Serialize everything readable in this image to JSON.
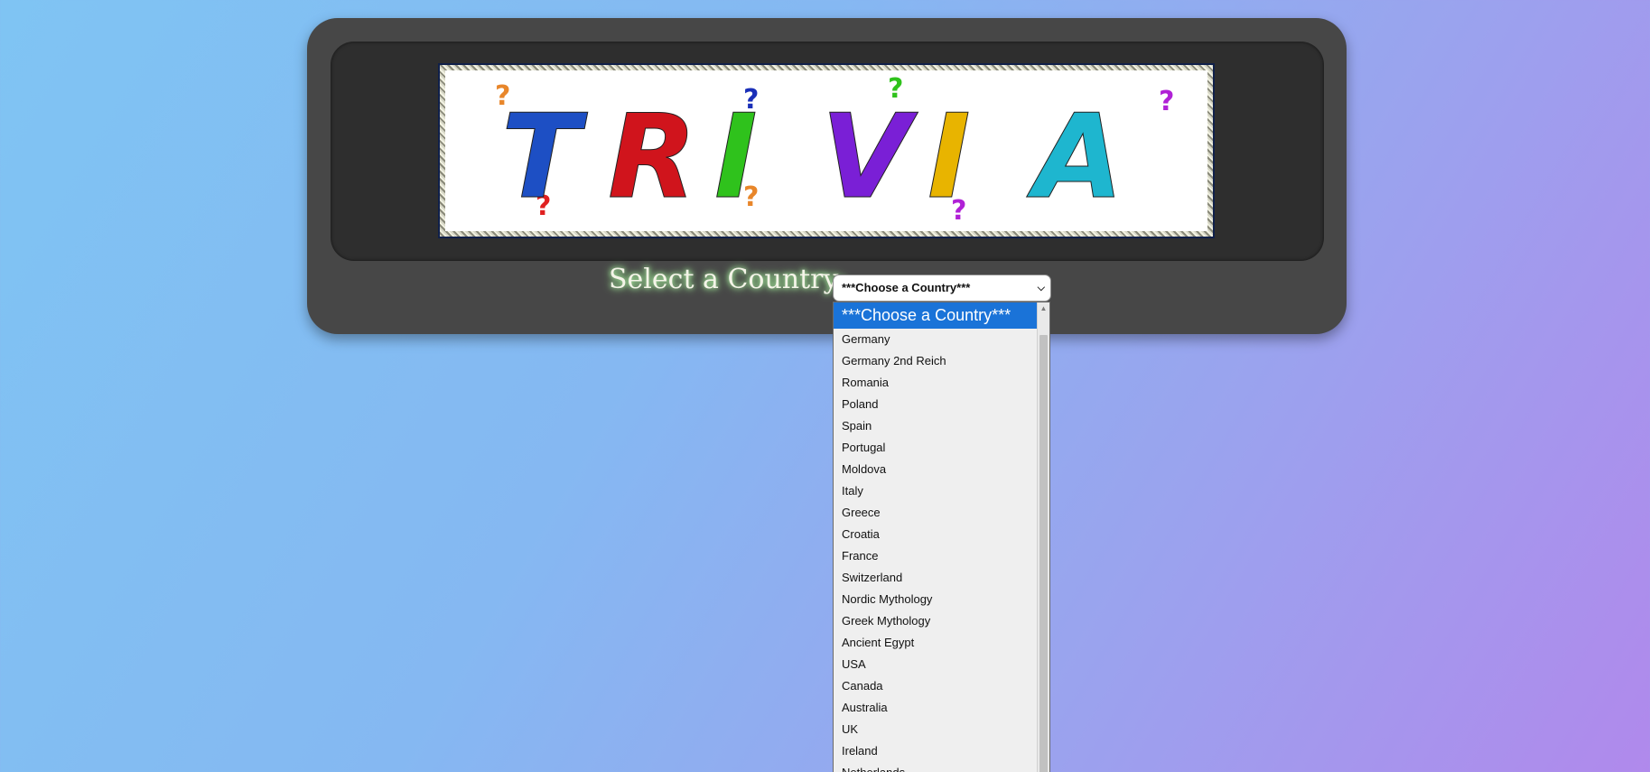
{
  "banner": {
    "logo_text": "TRIVIA",
    "letter_colors": [
      "#1d4fc4",
      "#d0141c",
      "#2fc21c",
      "#7a1fd6",
      "#e8b400",
      "#1eb6cf"
    ]
  },
  "selector": {
    "label": "Select a Country:",
    "selected_value": "***Choose a Country***"
  },
  "dropdown": {
    "options": [
      "***Choose a Country***",
      "Germany",
      "Germany 2nd Reich",
      "Romania",
      "Poland",
      "Spain",
      "Portugal",
      "Moldova",
      "Italy",
      "Greece",
      "Croatia",
      "France",
      "Switzerland",
      "Nordic Mythology",
      "Greek Mythology",
      "Ancient Egypt",
      "USA",
      "Canada",
      "Australia",
      "UK",
      "Ireland",
      "Netherlands"
    ],
    "highlight_color": "#1a73d8"
  }
}
